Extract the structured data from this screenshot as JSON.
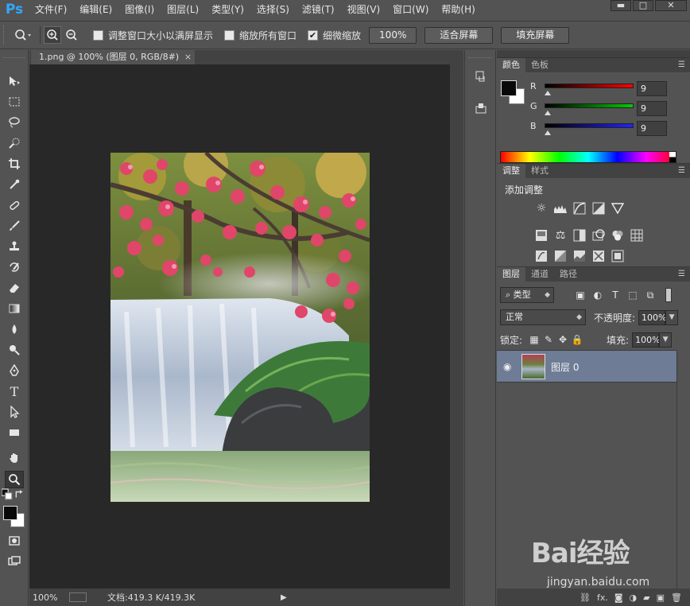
{
  "app": {
    "logo": "Ps"
  },
  "menu": [
    "文件(F)",
    "编辑(E)",
    "图像(I)",
    "图层(L)",
    "类型(Y)",
    "选择(S)",
    "滤镜(T)",
    "视图(V)",
    "窗口(W)",
    "帮助(H)"
  ],
  "window_controls": {
    "minimize": "▬",
    "maximize": "□",
    "close": "✕"
  },
  "options": {
    "resize_windows_label": "调整窗口大小以满屏显示",
    "resize_windows_checked": false,
    "zoom_all_label": "缩放所有窗口",
    "zoom_all_checked": false,
    "scrubby_zoom_label": "细微缩放",
    "scrubby_zoom_checked": true,
    "zoom_100_button": "100%",
    "fit_screen_button": "适合屏幕",
    "fill_screen_button": "填充屏幕"
  },
  "document": {
    "tab_title": "1.png @ 100% (图层 0, RGB/8#)",
    "tab_close": "×",
    "status_zoom": "100%",
    "status_doc": "文档:419.3 K/419.3K",
    "status_arrow": "▶"
  },
  "tools": [
    "move-tool",
    "marquee-tool",
    "lasso-tool",
    "quick-select-tool",
    "crop-tool",
    "eyedropper-tool",
    "healing-brush-tool",
    "brush-tool",
    "clone-stamp-tool",
    "history-brush-tool",
    "eraser-tool",
    "gradient-tool",
    "blur-tool",
    "dodge-tool",
    "pen-tool",
    "type-tool",
    "path-select-tool",
    "rectangle-tool",
    "hand-tool",
    "zoom-tool"
  ],
  "active_tool": "zoom-tool",
  "colors": {
    "foreground": "#090909",
    "background": "#ffffff",
    "layer_selected": "#6e7c95",
    "canvas_bg": "#282828"
  },
  "color_panel": {
    "tabs": [
      "颜色",
      "色板"
    ],
    "channels": [
      {
        "label": "R",
        "value": "9"
      },
      {
        "label": "G",
        "value": "9"
      },
      {
        "label": "B",
        "value": "9"
      }
    ]
  },
  "adjustments_panel": {
    "tabs": [
      "调整",
      "样式"
    ],
    "title": "添加调整"
  },
  "layers_panel": {
    "tabs": [
      "图层",
      "通道",
      "路径"
    ],
    "filter_select": "类型",
    "blend_mode": "正常",
    "opacity_label": "不透明度:",
    "opacity_value": "100%",
    "lock_label": "锁定:",
    "fill_label": "填充:",
    "fill_value": "100%",
    "layers": [
      {
        "name": "图层 0",
        "visible": true
      }
    ],
    "footer_fx": "fx."
  },
  "watermark": {
    "logo": "Bai经验",
    "url": "jingyan.baidu.com"
  }
}
